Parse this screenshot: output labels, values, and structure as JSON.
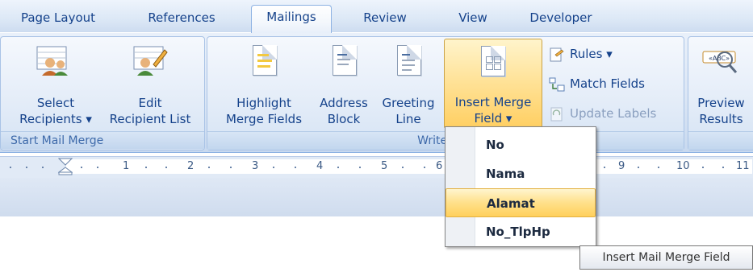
{
  "tabs": [
    {
      "label": "Page Layout"
    },
    {
      "label": "References"
    },
    {
      "label": "Mailings",
      "active": true
    },
    {
      "label": "Review"
    },
    {
      "label": "View"
    },
    {
      "label": "Developer"
    }
  ],
  "ribbon": {
    "start_mail_merge": {
      "group_label": "Start Mail Merge",
      "select_recipients": {
        "line1": "Select",
        "line2": "Recipients ▾"
      },
      "edit_recipient_list": {
        "line1": "Edit",
        "line2": "Recipient List"
      }
    },
    "write_insert": {
      "group_label": "Write & In",
      "highlight_merge_fields": {
        "line1": "Highlight",
        "line2": "Merge Fields"
      },
      "address_block": {
        "line1": "Address",
        "line2": "Block"
      },
      "greeting_line": {
        "line1": "Greeting",
        "line2": "Line"
      },
      "insert_merge_field": {
        "line1": "Insert Merge",
        "line2": "Field ▾"
      },
      "rules": "Rules ▾",
      "match_fields": "Match Fields",
      "update_labels": "Update Labels"
    },
    "preview": {
      "preview_results": {
        "line1": "Preview",
        "line2": "Results"
      }
    }
  },
  "ruler": {
    "numbers": [
      "1",
      "2",
      "3",
      "4",
      "5",
      "6",
      "9",
      "10",
      "11"
    ]
  },
  "dropdown": {
    "items": [
      {
        "label": "No"
      },
      {
        "label": "Nama"
      },
      {
        "label": "Alamat",
        "highlighted": true
      },
      {
        "label": "No_TlpHp"
      }
    ]
  },
  "tooltip": "Insert Mail Merge Field",
  "colors": {
    "accent_text": "#15428b",
    "menu_highlight": "#ffd05c"
  }
}
